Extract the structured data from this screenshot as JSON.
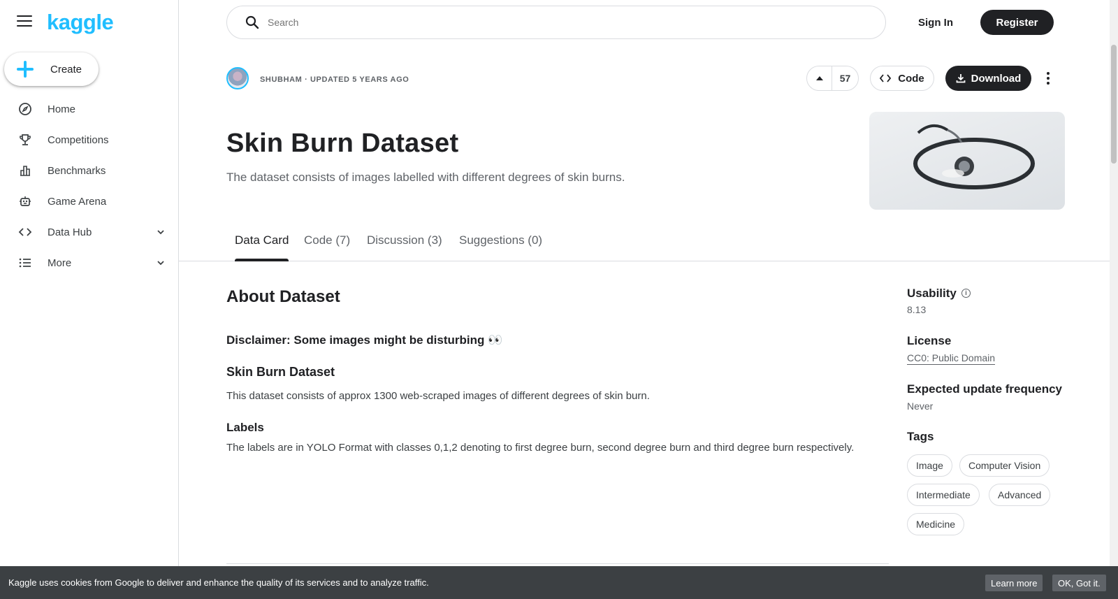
{
  "brand": {
    "logo": "kaggle",
    "accent": "#20beff"
  },
  "sidebar": {
    "create_label": "Create",
    "items": [
      {
        "label": "Home",
        "icon": "compass-icon"
      },
      {
        "label": "Competitions",
        "icon": "trophy-icon"
      },
      {
        "label": "Benchmarks",
        "icon": "bar-chart-icon"
      },
      {
        "label": "Game Arena",
        "icon": "robot-icon"
      },
      {
        "label": "Data Hub",
        "icon": "code-icon",
        "expandable": true
      },
      {
        "label": "More",
        "icon": "list-icon",
        "expandable": true
      }
    ]
  },
  "topbar": {
    "search_placeholder": "Search",
    "signin_label": "Sign In",
    "register_label": "Register"
  },
  "dataset": {
    "owner_line": "SHUBHAM · UPDATED 5 YEARS AGO",
    "votes": "57",
    "code_label": "Code",
    "download_label": "Download",
    "title": "Skin Burn Dataset",
    "subtitle": "The dataset consists of images labelled with different degrees of skin burns."
  },
  "tabs": [
    {
      "label": "Data Card",
      "active": true
    },
    {
      "label": "Code (7)",
      "active": false
    },
    {
      "label": "Discussion (3)",
      "active": false
    },
    {
      "label": "Suggestions (0)",
      "active": false
    }
  ],
  "content": {
    "about_heading": "About Dataset",
    "disclaimer": "Disclaimer: Some images might be disturbing 👀",
    "section_title": "Skin Burn Dataset",
    "section_text": "This dataset consists of approx 1300 web-scraped images of different degrees of skin burn.",
    "labels_heading": "Labels",
    "labels_text": "The labels are in YOLO Format with classes 0,1,2 denoting to first degree burn, second degree burn and third degree burn respectively."
  },
  "meta": {
    "usability_label": "Usability",
    "usability_value": "8.13",
    "license_label": "License",
    "license_value": "CC0: Public Domain",
    "frequency_label": "Expected update frequency",
    "frequency_value": "Never",
    "tags_label": "Tags",
    "tags": [
      "Image",
      "Computer Vision",
      "Intermediate",
      "Advanced",
      "Medicine"
    ]
  },
  "cookie": {
    "message": "Kaggle uses cookies from Google to deliver and enhance the quality of its services and to analyze traffic.",
    "learn_more": "Learn more",
    "ok": "OK, Got it."
  }
}
